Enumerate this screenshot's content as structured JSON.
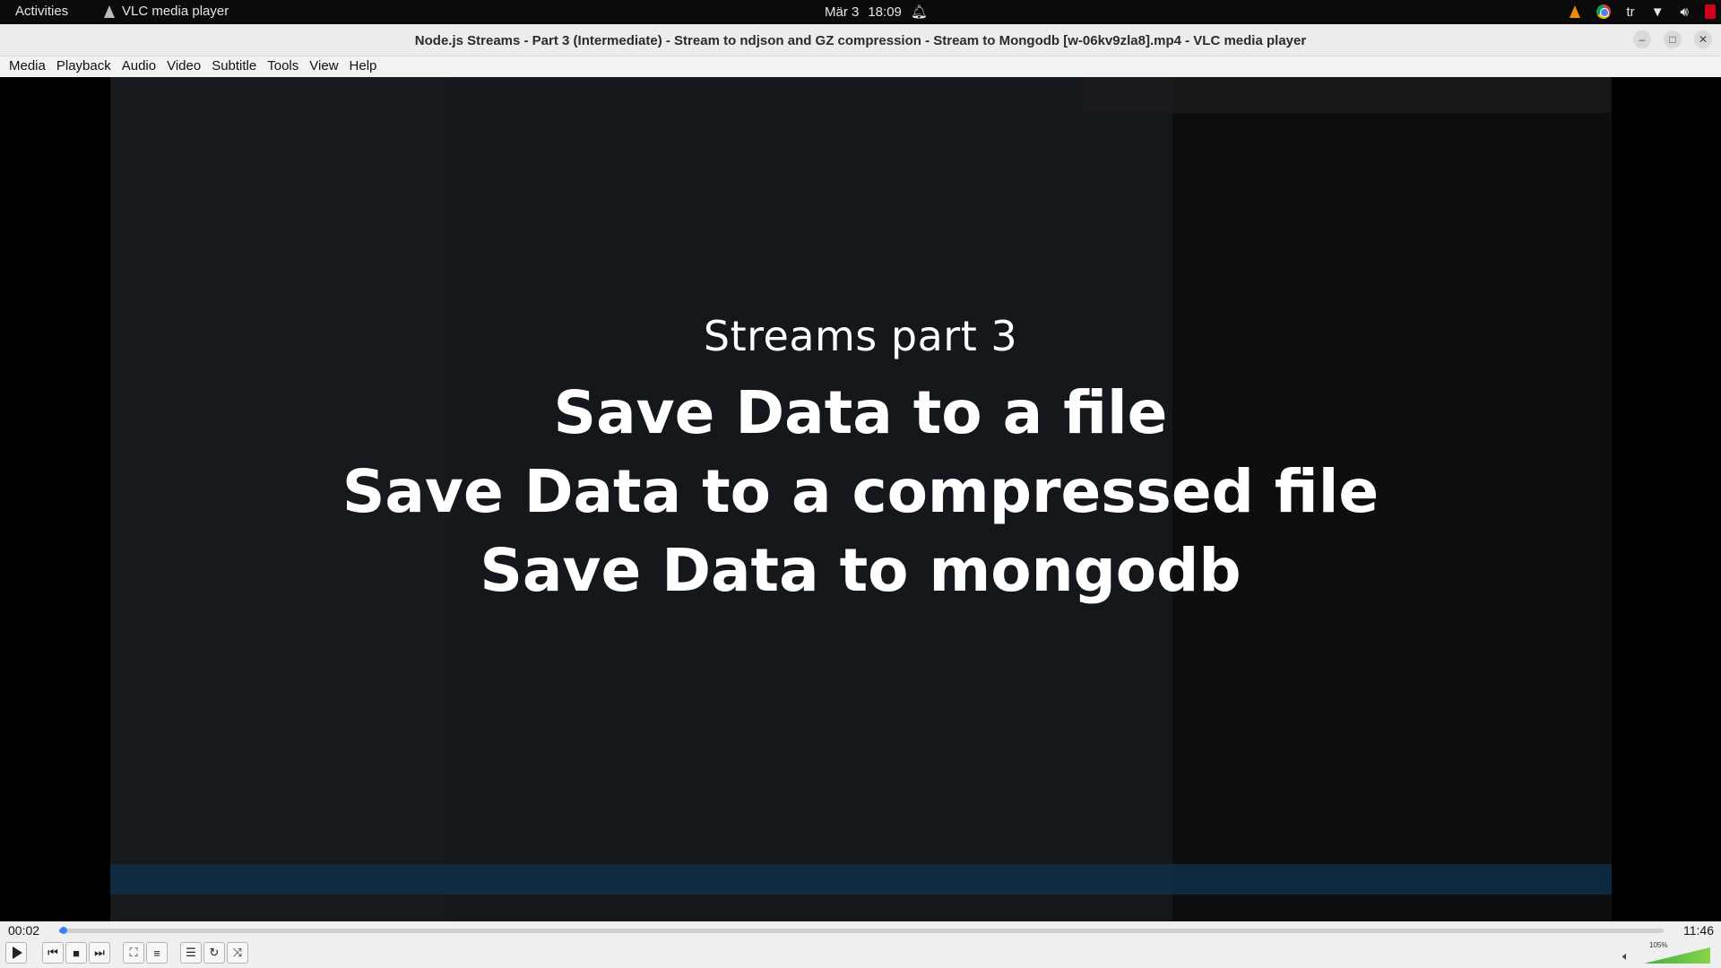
{
  "topbar": {
    "activities": "Activities",
    "app_name": "VLC media player",
    "date": "Mär 3",
    "time": "18:09",
    "keyboard_layout": "tr"
  },
  "window": {
    "title": "Node.js Streams - Part 3 (Intermediate) - Stream to ndjson and GZ compression - Stream to Mongodb [w-06kv9zla8].mp4 - VLC media player"
  },
  "menu": [
    "Media",
    "Playback",
    "Audio",
    "Video",
    "Subtitle",
    "Tools",
    "View",
    "Help"
  ],
  "video": {
    "subtitle": "Streams part 3",
    "line1": "Save Data to a file",
    "line2": "Save Data to a compressed file",
    "line3": "Save Data to mongodb"
  },
  "player": {
    "elapsed": "00:02",
    "total": "11:46",
    "progress": 0.003,
    "volume_percent": "105%",
    "volume_level": 1.05
  },
  "colors": {
    "accent": "#3b82f6",
    "vlc_orange": "#f08a00",
    "volume_green": "#3cb043"
  },
  "icons": {
    "vlc": "vlc-cone-icon",
    "bell": "bell-icon",
    "chrome": "chrome-icon",
    "wifi": "wifi-icon",
    "speaker": "speaker-icon",
    "power": "power-icon"
  }
}
